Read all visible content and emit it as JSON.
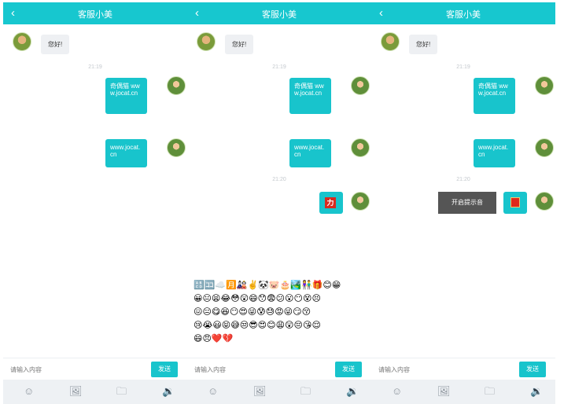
{
  "header": {
    "back": "‹",
    "title": "客服小美"
  },
  "messages": {
    "greeting": "您好!",
    "time1": "21:19",
    "out1": "奇偶猫 www.jocat.cn",
    "out2": "www.jocat.cn",
    "time2": "21:20",
    "sticker": "力"
  },
  "toast": "开启提示音",
  "input": {
    "placeholder": "请输入内容",
    "send": "发送"
  },
  "toolbar": {
    "emoji": "☺",
    "image": "🖼",
    "folder": "🗀",
    "sound": "🔉"
  },
  "emojis": [
    "🔠🈁☁️🈷️🎎✌️🐼🐷🎂🏞️👫🎁😊😁",
    "😀😐😫😂😳😲😄😯😨😕😮😶😵😣",
    "😖😑😋😆😶😍😜😰😓😡😜😏😚",
    "😢😭😃😝😅😒😎😍😊😩😲😔😘😌",
    "😄😠❤️💔"
  ],
  "colors": {
    "accent": "#17c7cf",
    "bubble_in": "#eef0f3"
  }
}
